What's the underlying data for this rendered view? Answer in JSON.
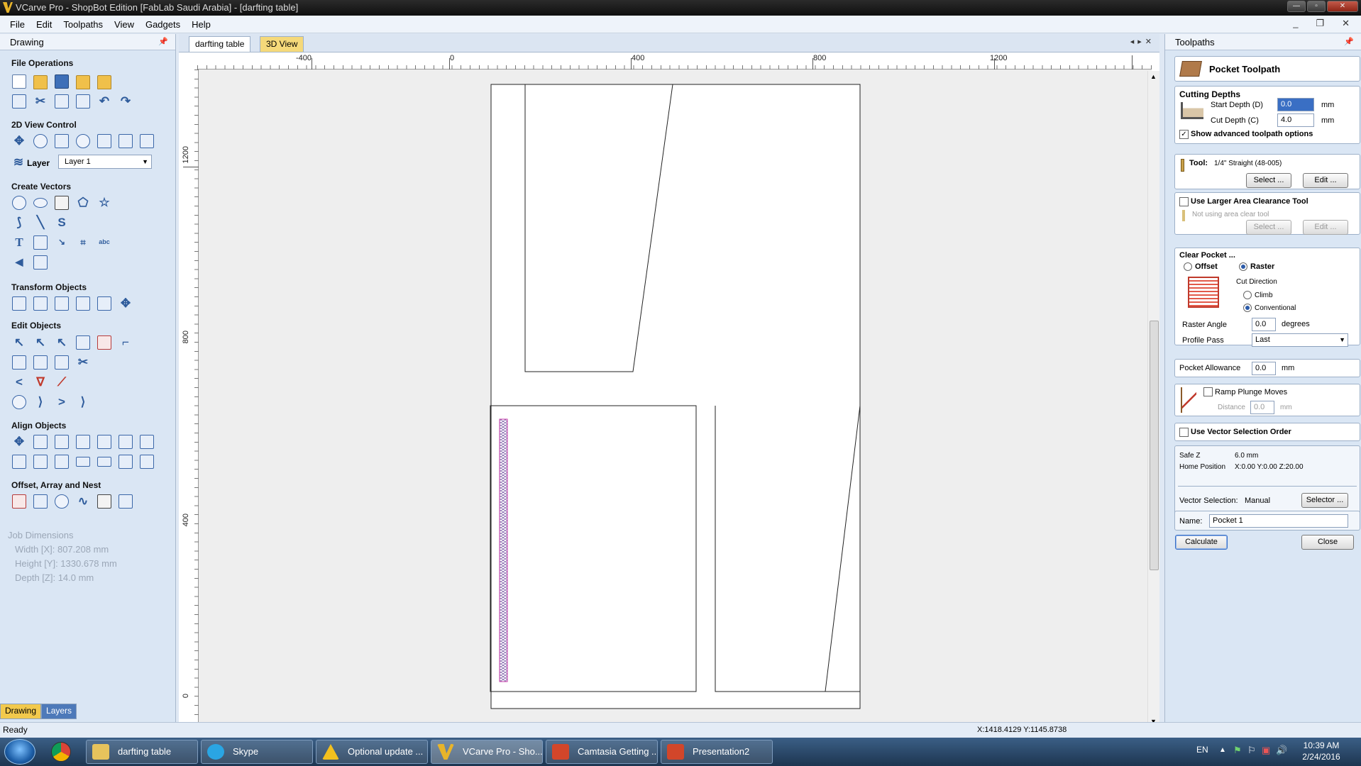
{
  "window": {
    "title": "VCarve Pro - ShopBot Edition [FabLab Saudi Arabia] - [darfting table]"
  },
  "menu": [
    "File",
    "Edit",
    "Toolpaths",
    "View",
    "Gadgets",
    "Help"
  ],
  "left_panel": {
    "title": "Drawing",
    "sections": {
      "file_ops": "File Operations",
      "view_control": "2D View Control",
      "create_vectors": "Create Vectors",
      "transform": "Transform Objects",
      "edit_objects": "Edit Objects",
      "align": "Align Objects",
      "offset": "Offset, Array and Nest"
    },
    "layer_label": "Layer",
    "layer_value": "Layer 1",
    "job_dimensions": {
      "title": "Job Dimensions",
      "width": "Width  [X]: 807.208 mm",
      "height": "Height [Y]: 1330.678 mm",
      "depth": "Depth  [Z]: 14.0 mm"
    },
    "tabs": [
      "Drawing",
      "Layers"
    ]
  },
  "doc_tabs": [
    "darfting table",
    "3D View"
  ],
  "ruler": {
    "h_labels": [
      "-400",
      "0",
      "400",
      "800",
      "1200"
    ],
    "v_labels": [
      "1200",
      "800",
      "400",
      "0"
    ]
  },
  "toolpaths_panel": {
    "title": "Toolpaths",
    "heading": "Pocket Toolpath",
    "cutting_depths": {
      "title": "Cutting Depths",
      "start_label": "Start Depth (D)",
      "start_value": "0.0",
      "cut_label": "Cut Depth (C)",
      "cut_value": "4.0",
      "unit": "mm"
    },
    "show_advanced": "Show advanced toolpath options",
    "tool": {
      "label": "Tool:",
      "name": "1/4\" Straight  (48-005)",
      "select": "Select ...",
      "edit": "Edit ..."
    },
    "larger_area": {
      "label": "Use Larger Area Clearance Tool",
      "note": "Not using area clear tool",
      "select": "Select ...",
      "edit": "Edit ..."
    },
    "clear_pocket": {
      "title": "Clear Pocket ...",
      "offset": "Offset",
      "raster": "Raster",
      "cut_direction": "Cut Direction",
      "climb": "Climb",
      "conventional": "Conventional",
      "raster_angle_label": "Raster Angle",
      "raster_angle_value": "0.0",
      "degrees": "degrees",
      "profile_pass_label": "Profile Pass",
      "profile_pass_value": "Last"
    },
    "pocket_allowance": {
      "label": "Pocket Allowance",
      "value": "0.0",
      "unit": "mm"
    },
    "ramp": {
      "label": "Ramp Plunge Moves",
      "distance_label": "Distance",
      "distance_value": "0.0",
      "unit": "mm"
    },
    "vector_order": "Use Vector Selection Order",
    "safe_z": {
      "label": "Safe Z",
      "value": "6.0 mm"
    },
    "home": {
      "label": "Home Position",
      "value": "X:0.00 Y:0.00 Z:20.00"
    },
    "vector_selection": {
      "label": "Vector Selection:",
      "value": "Manual",
      "button": "Selector ..."
    },
    "name": {
      "label": "Name:",
      "value": "Pocket 1"
    },
    "calculate": "Calculate",
    "close": "Close"
  },
  "status": {
    "left": "Ready",
    "coords": "X:1418.4129 Y:1145.8738"
  },
  "taskbar": {
    "items": [
      "darfting table",
      "Skype",
      "Optional update ...",
      "VCarve Pro - Sho...",
      "Camtasia Getting ...",
      "Presentation2"
    ],
    "lang": "EN",
    "time": "10:39 AM",
    "date": "2/24/2016"
  }
}
